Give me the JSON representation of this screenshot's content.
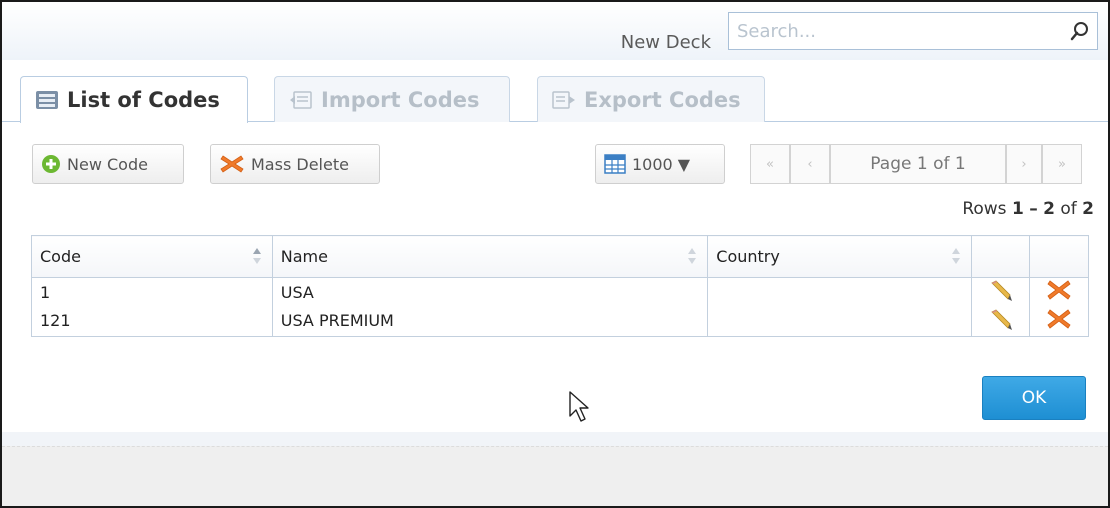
{
  "header": {
    "deck_label": "New Deck",
    "search_placeholder": "Search..."
  },
  "tabs": [
    {
      "label": "List of Codes",
      "active": true,
      "icon": "list-icon"
    },
    {
      "label": "Import Codes",
      "active": false,
      "icon": "import-icon"
    },
    {
      "label": "Export Codes",
      "active": false,
      "icon": "export-icon"
    }
  ],
  "toolbar": {
    "new_code_label": "New Code",
    "mass_delete_label": "Mass Delete",
    "page_size": "1000 ▼",
    "page_info": "Page 1 of 1",
    "first_glyph": "«",
    "prev_glyph": "‹",
    "next_glyph": "›",
    "last_glyph": "»"
  },
  "rows_info": {
    "prefix": "Rows",
    "start": "1",
    "sep": "–",
    "end": "2",
    "of": "of",
    "total": "2"
  },
  "table": {
    "columns": [
      "Code",
      "Name",
      "Country"
    ],
    "rows": [
      {
        "code": "1",
        "name": "USA",
        "country": ""
      },
      {
        "code": "121",
        "name": "USA PREMIUM",
        "country": ""
      }
    ]
  },
  "ok_label": "OK",
  "colors": {
    "accent": "#2196db",
    "delete": "#f07a2a",
    "add": "#6cb832"
  }
}
